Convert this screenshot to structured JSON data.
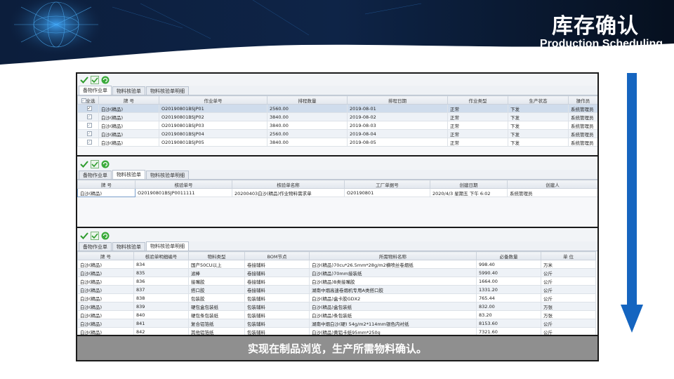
{
  "header": {
    "title_cn": "库存确认",
    "title_en": "Production Scheduling"
  },
  "colors": {
    "banner_dark": "#0b1a33",
    "banner_mid": "#16325c",
    "arrow_blue": "#1565c0",
    "caption_bg": "#8f8f8f"
  },
  "icons": {
    "save": "check-save-icon",
    "confirm": "check-confirm-icon",
    "refresh": "refresh-icon"
  },
  "panel1": {
    "tabs": [
      "备物作业单",
      "物料核验单",
      "物料核验单明细"
    ],
    "active_tab": 0,
    "headers": [
      "全选",
      "牌 号",
      "作业单号",
      "排程数量",
      "排程日期",
      "作业类型",
      "生产状态",
      "操作员"
    ],
    "rows": [
      {
        "checked": "on",
        "cells": [
          "白沙(精品)",
          "O20190801BSJP01",
          "2560.00",
          "2019-08-01",
          "正常",
          "下发",
          "系统管理员"
        ]
      },
      {
        "checked": "dim",
        "cells": [
          "白沙(精品)",
          "O20190801BSJP02",
          "3840.00",
          "2019-08-02",
          "正常",
          "下发",
          "系统管理员"
        ]
      },
      {
        "checked": "dim",
        "cells": [
          "白沙(精品)",
          "O20190801BSJP03",
          "3840.00",
          "2019-08-03",
          "正常",
          "下发",
          "系统管理员"
        ]
      },
      {
        "checked": "dim",
        "cells": [
          "白沙(精品)",
          "O20190801BSJP04",
          "2560.00",
          "2019-08-04",
          "正常",
          "下发",
          "系统管理员"
        ]
      },
      {
        "checked": "dim",
        "cells": [
          "白沙(精品)",
          "O20190801BSJP05",
          "3840.00",
          "2019-08-05",
          "正常",
          "下发",
          "系统管理员"
        ]
      }
    ]
  },
  "panel2": {
    "tabs": [
      "备物作业单",
      "物料核验单",
      "物料核验单明细"
    ],
    "active_tab": 1,
    "headers": [
      "牌 号",
      "核验单号",
      "核验单名称",
      "工厂单据号",
      "创建日期",
      "创建人"
    ],
    "rows": [
      {
        "cells": [
          "白沙(精品)",
          "O20190801BSJP0011111",
          "20200403白沙(精品)作业物料需求单",
          "O20190801",
          "2020/4/3 星期五 下午 6:02",
          "系统管理员"
        ]
      }
    ]
  },
  "panel3": {
    "tabs": [
      "备物作业单",
      "物料核验单",
      "物料核验单明细"
    ],
    "active_tab": 2,
    "headers": [
      "牌 号",
      "核验单明细编号",
      "物料类型",
      "BOM节点",
      "所需物料名称",
      "必备数量",
      "单 位"
    ],
    "rows": [
      {
        "cells": [
          "白沙(精品)",
          "834",
          "国产50CU以上",
          "卷接辅料",
          "白沙(精品)70cu*26.5mm*28g/m2横喷丝卷烟纸",
          "998.40",
          "万米"
        ]
      },
      {
        "cells": [
          "白沙(精品)",
          "835",
          "滤棒",
          "卷接辅料",
          "白沙(精品)70mm接装纸",
          "5990.40",
          "公斤"
        ]
      },
      {
        "cells": [
          "白沙(精品)",
          "836",
          "接嘴胶",
          "卷接辅料",
          "白沙(精品)B类接嘴胶",
          "1664.00",
          "公斤"
        ]
      },
      {
        "cells": [
          "白沙(精品)",
          "837",
          "搭口胶",
          "卷接辅料",
          "湖南中烟高速卷烟机专用A类搭口胶",
          "1331.20",
          "公斤"
        ]
      },
      {
        "cells": [
          "白沙(精品)",
          "838",
          "包装胶",
          "包装辅料",
          "白沙(精品)盒卡胶GDX2",
          "765.44",
          "公斤"
        ]
      },
      {
        "cells": [
          "白沙(精品)",
          "839",
          "硬包盒包装纸",
          "包装辅料",
          "白沙(精品)盒包装纸",
          "832.00",
          "万张"
        ]
      },
      {
        "cells": [
          "白沙(精品)",
          "840",
          "硬包条包装纸",
          "包装辅料",
          "白沙(精品)条包装纸",
          "83.20",
          "万张"
        ]
      },
      {
        "cells": [
          "白沙(精品)",
          "841",
          "复合铝箔纸",
          "包装辅料",
          "湖南中烟白沙(硬) 54g/m2*114mm银色内衬纸",
          "8153.60",
          "公斤"
        ]
      },
      {
        "cells": [
          "白沙(精品)",
          "842",
          "其他铝箔纸",
          "包装辅料",
          "白沙(精品)黄铝卡纸95mm*250g",
          "7321.60",
          "公斤"
        ]
      }
    ]
  },
  "caption": "实现在制品浏览，生产所需物料确认。"
}
